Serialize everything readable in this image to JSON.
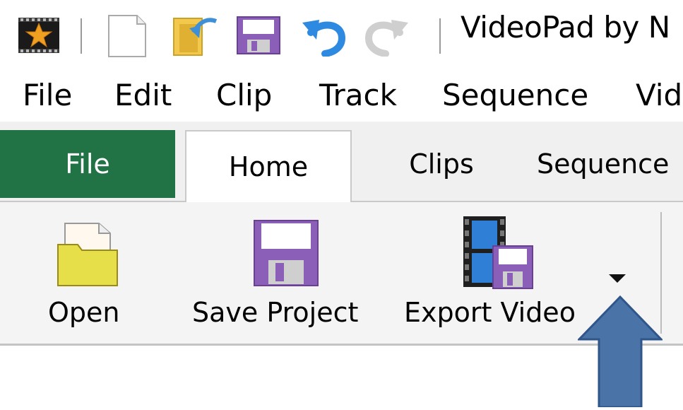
{
  "window": {
    "title": "VideoPad by N"
  },
  "quick_access": {
    "icons": [
      "app-star-icon",
      "new-file-icon",
      "open-folder-icon",
      "save-icon",
      "undo-icon",
      "redo-icon"
    ]
  },
  "menu": {
    "items": [
      "File",
      "Edit",
      "Clip",
      "Track",
      "Sequence",
      "Vid"
    ]
  },
  "tabs": {
    "items": [
      "File",
      "Home",
      "Clips",
      "Sequence"
    ],
    "active": "Home"
  },
  "ribbon": {
    "open_label": "Open",
    "save_label": "Save Project",
    "export_label": "Export Video"
  },
  "colors": {
    "file_tab": "#217346",
    "arrow": "#4a74a8",
    "purple_disk": "#8b5fb8",
    "folder_yellow": "#e6df4a"
  }
}
